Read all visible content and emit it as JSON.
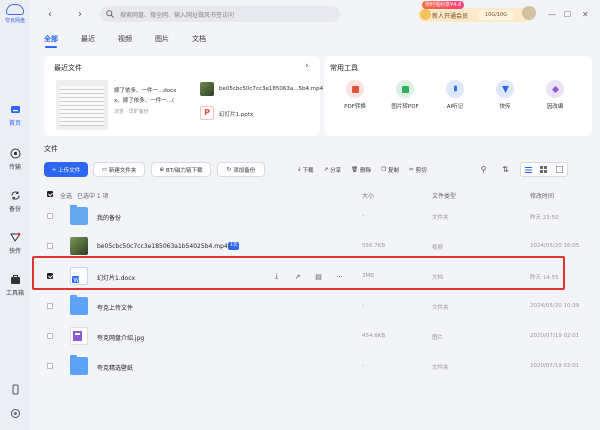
{
  "app": {
    "logo_text": "夸克网盘"
  },
  "sidebar": {
    "items": [
      {
        "label": "首页",
        "icon": "home-icon"
      },
      {
        "label": "传输",
        "icon": "transfer-icon"
      },
      {
        "label": "备份",
        "icon": "backup-icon"
      },
      {
        "label": "快传",
        "icon": "quick-transfer-icon"
      },
      {
        "label": "工具箱",
        "icon": "toolbox-icon"
      }
    ]
  },
  "topbar": {
    "search_placeholder": "搜索网盘、搜全网、输入网址做风书签访问",
    "promo_tag": "限时福利享¥4.8",
    "promo_label": "新人开通会员",
    "quota": "10G/10G"
  },
  "tabs": [
    "全部",
    "最近",
    "视频",
    "图片",
    "文档"
  ],
  "recent": {
    "title": "最近文件",
    "arrow": "›",
    "thumb_file_lines": [
      "嫁了依多、一件一...docx",
      "x、嫁了依多、一件一...(",
      "浏览 · 早旷备份"
    ],
    "items": [
      {
        "name": "be05cbc50c7cc3e185063a...5b4.mp4"
      },
      {
        "name": "幻灯片1.pptx"
      }
    ]
  },
  "tools": {
    "title": "常用工具",
    "items": [
      {
        "label": "PDF转换",
        "color": "#fbe3df",
        "accent": "#e5533b"
      },
      {
        "label": "图片转PDF",
        "color": "#dcf1e3",
        "accent": "#2fae5e"
      },
      {
        "label": "AI听记",
        "color": "#dde8fb",
        "accent": "#3a6cf5"
      },
      {
        "label": "快传",
        "color": "#dde8fb",
        "accent": "#2d66f0"
      },
      {
        "label": "因改编",
        "color": "#ece3f8",
        "accent": "#8a5ad8"
      }
    ]
  },
  "files_section": {
    "title": "文件",
    "buttons": {
      "upload": "上传文件",
      "new_folder": "新建文件夹",
      "bt": "BT/磁力链下载",
      "add_backup": "添加备份"
    },
    "ops": [
      "下载",
      "分享",
      "删除",
      "复制",
      "剪切"
    ]
  },
  "list": {
    "select_all": "全选",
    "selected": "已选中 1 项",
    "col_size": "大小",
    "col_type": "文件类型",
    "col_date": "修改时间",
    "rows": [
      {
        "name": "我的备份",
        "size": "-",
        "type": "文件夹",
        "date": "昨天 23:50",
        "kind": "backup",
        "checked": false
      },
      {
        "name": "be05cbc50c7cc3e185063a1b54025b4.mp4",
        "badge": "1次",
        "size": "556.7KB",
        "type": "视频",
        "date": "2024/05/20 16:05",
        "kind": "video",
        "checked": false
      },
      {
        "name": "幻灯片1.docx",
        "size": "3MB",
        "type": "文档",
        "date": "昨天 14:55",
        "kind": "word",
        "checked": true
      },
      {
        "name": "夸克上传文件",
        "size": "-",
        "type": "文件夹",
        "date": "2024/05/20 10:39",
        "kind": "folder",
        "checked": false
      },
      {
        "name": "夸克网盘介绍.jpg",
        "size": "454.6KB",
        "type": "图片",
        "date": "2020/07/19 02:01",
        "kind": "image",
        "checked": false
      },
      {
        "name": "夸克精选壁纸",
        "size": "-",
        "type": "文件夹",
        "date": "2020/07/19 02:01",
        "kind": "folder",
        "checked": false
      }
    ]
  },
  "colors": {
    "accent": "#2d66f0",
    "highlight": "#e0322f",
    "folder": "#5ea2f7"
  }
}
